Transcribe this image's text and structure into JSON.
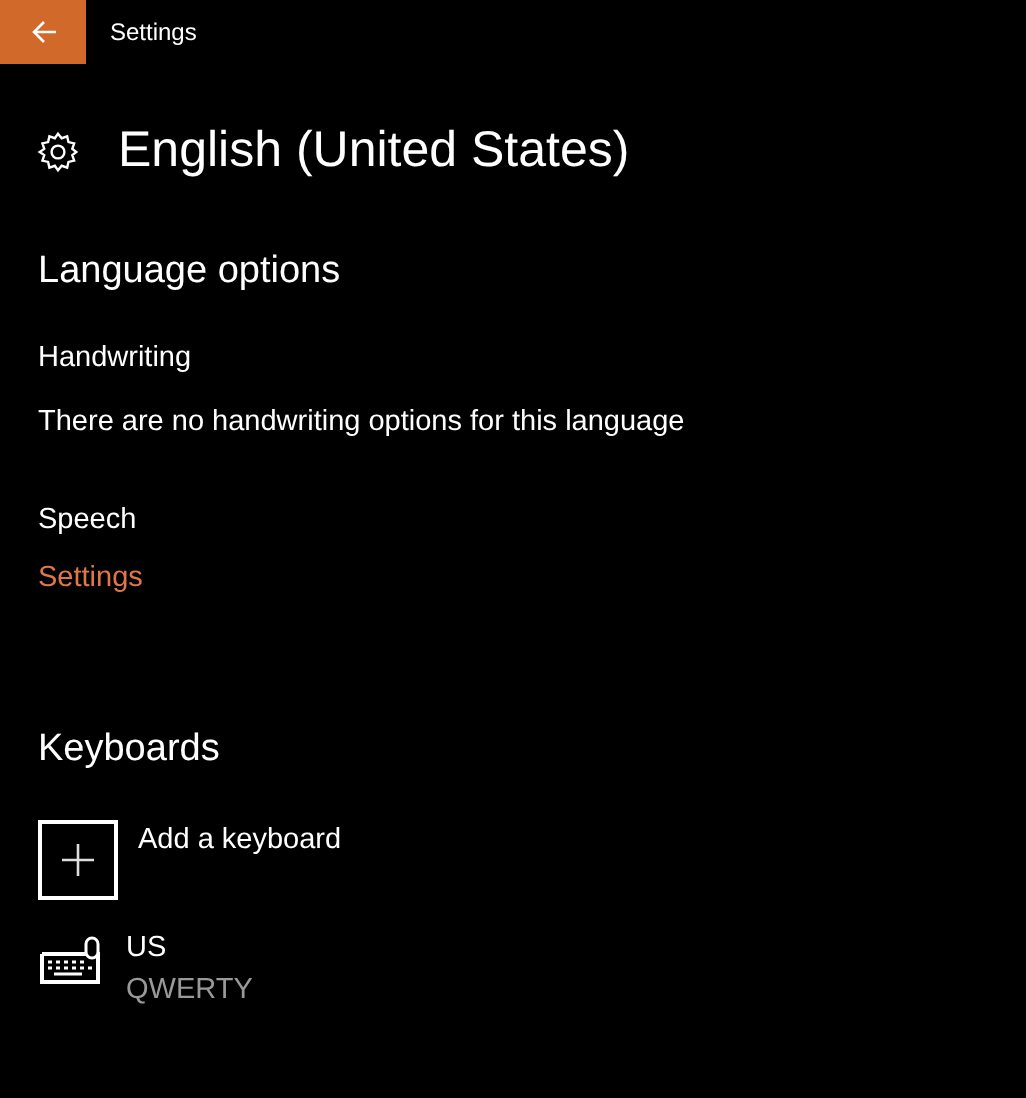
{
  "window": {
    "title": "Settings"
  },
  "page": {
    "title": "English (United States)"
  },
  "language_options": {
    "heading": "Language options",
    "handwriting": {
      "label": "Handwriting",
      "text": "There are no handwriting options for this language"
    },
    "speech": {
      "label": "Speech",
      "link": "Settings"
    }
  },
  "keyboards": {
    "heading": "Keyboards",
    "add_label": "Add a keyboard",
    "items": [
      {
        "name": "US",
        "layout": "QWERTY"
      }
    ]
  }
}
